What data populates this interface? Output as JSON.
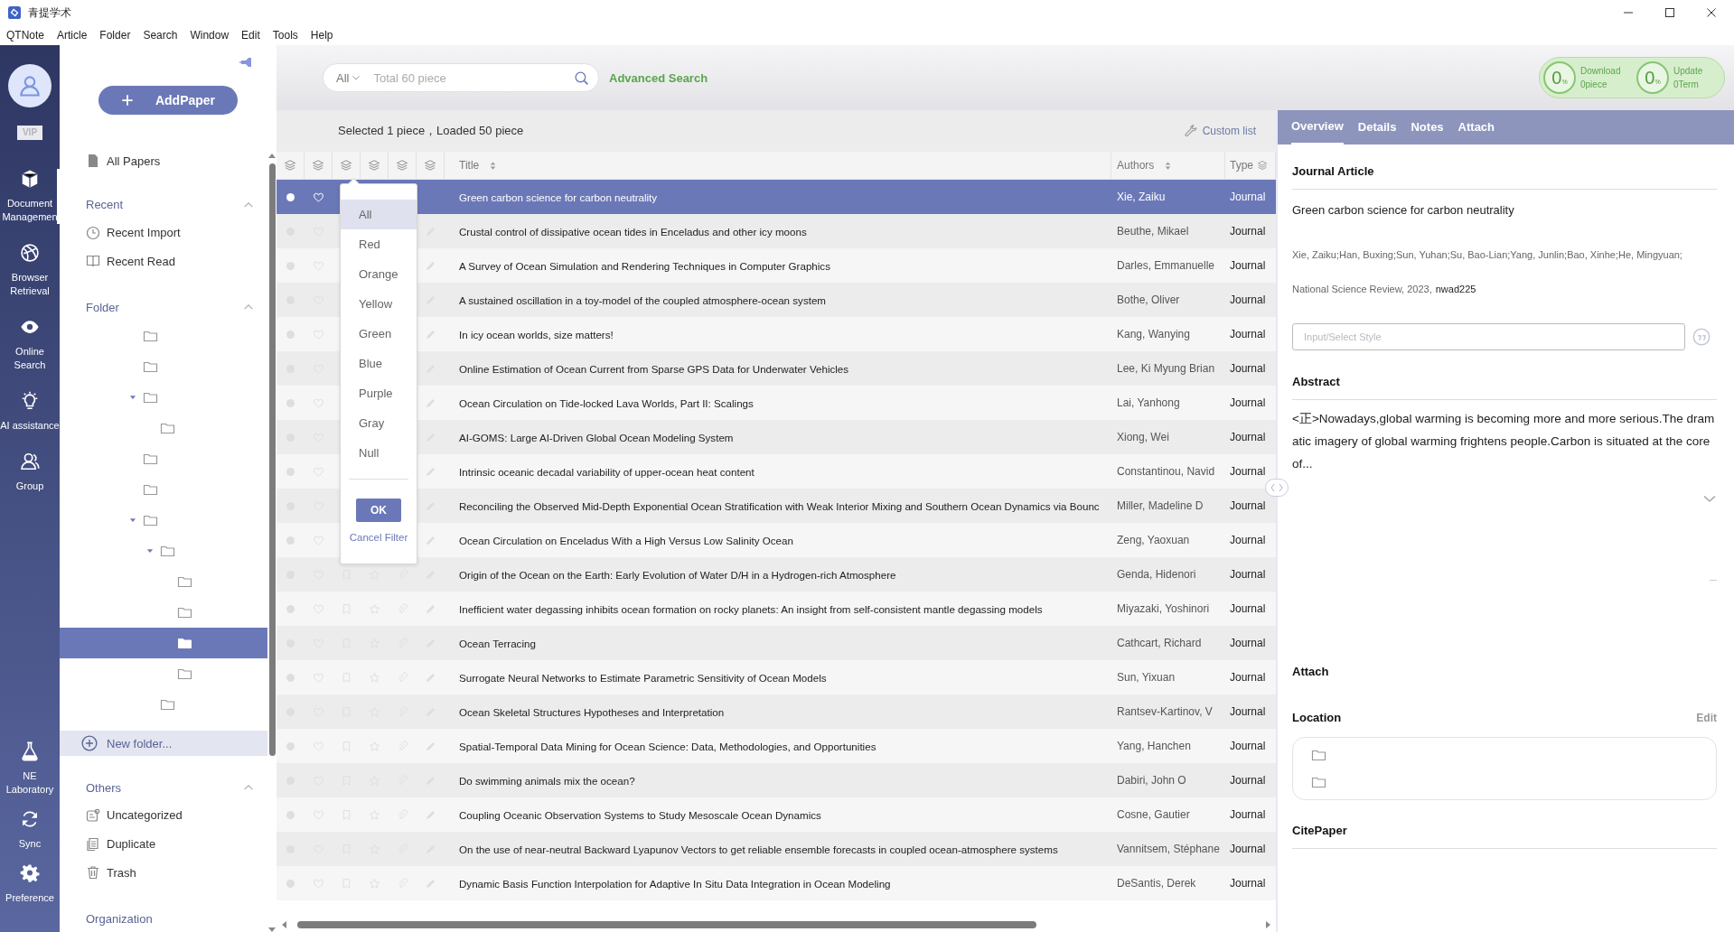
{
  "window": {
    "title": "青提学术"
  },
  "menu": [
    "QTNote",
    "Article",
    "Folder",
    "Search",
    "Window",
    "Edit",
    "Tools",
    "Help"
  ],
  "nav": {
    "badge": "VIP",
    "items": [
      {
        "label": "Document Managemen",
        "selected": true
      },
      {
        "label": "Browser Retrieval",
        "selected": false
      },
      {
        "label": "Online Search",
        "selected": false
      },
      {
        "label": "AI assistance",
        "selected": false
      },
      {
        "label": "Group",
        "selected": false
      }
    ],
    "bottom_items": [
      {
        "label": "NE Laboratory",
        "selected": false
      },
      {
        "label": "Sync",
        "selected": false
      },
      {
        "label": "Preference",
        "selected": false
      }
    ]
  },
  "sidebar": {
    "add_button": "AddPaper",
    "all_papers": "All Papers",
    "recent": {
      "title": "Recent",
      "expanded": true,
      "items": [
        "Recent Import",
        "Recent Read"
      ]
    },
    "folder": {
      "title": "Folder",
      "expanded": true,
      "new_folder": "New folder...",
      "folders": [
        {
          "selected": false
        },
        {
          "selected": false
        },
        {
          "selected": false,
          "expanded": true,
          "children": [
            {
              "selected": false
            }
          ]
        },
        {
          "selected": false
        },
        {
          "selected": false
        },
        {
          "selected": false,
          "expanded": true,
          "children": [
            {
              "selected": false,
              "expanded": true,
              "children": [
                {
                  "selected": false
                },
                {
                  "selected": false
                },
                {
                  "selected": true
                },
                {
                  "selected": false
                }
              ]
            },
            {
              "selected": false
            }
          ]
        }
      ]
    },
    "others": {
      "title": "Others",
      "expanded": true,
      "items": [
        "Uncategorized",
        "Duplicate",
        "Trash"
      ]
    },
    "organization": {
      "title": "Organization"
    }
  },
  "toolbar": {
    "filter": "All",
    "placeholder": "Total 60 piece",
    "advanced_search": "Advanced Search",
    "progress": [
      {
        "value": "0",
        "unit": "%",
        "label": "Download",
        "detail": "0piece"
      },
      {
        "value": "0",
        "unit": "%",
        "label": "Update",
        "detail": "0Term"
      }
    ]
  },
  "table": {
    "summary": "Selected 1 piece，Loaded 50 piece",
    "custom_list": "Custom list",
    "columns": [
      "Title",
      "Authors",
      "Type"
    ],
    "rows": [
      {
        "title": "Green carbon science for carbon neutrality",
        "authors": "Xie, Zaiku",
        "type": "Journal",
        "selected": true
      },
      {
        "title": "Crustal control of dissipative ocean tides in Enceladus and other icy moons",
        "authors": "Beuthe, Mikael",
        "type": "Journal",
        "selected": false
      },
      {
        "title": "A Survey of Ocean Simulation and Rendering Techniques in Computer Graphics",
        "authors": "Darles, Emmanuelle",
        "type": "Journal",
        "selected": false
      },
      {
        "title": "A sustained oscillation in a toy-model of the coupled atmosphere-ocean system",
        "authors": "Bothe, Oliver",
        "type": "Journal",
        "selected": false
      },
      {
        "title": "In icy ocean worlds, size matters!",
        "authors": "Kang, Wanying",
        "type": "Journal",
        "selected": false
      },
      {
        "title": "Online Estimation of Ocean Current from Sparse GPS Data for Underwater Vehicles",
        "authors": "Lee, Ki Myung Brian",
        "type": "Journal",
        "selected": false
      },
      {
        "title": "Ocean Circulation on Tide-locked Lava Worlds, Part II: Scalings",
        "authors": "Lai, Yanhong",
        "type": "Journal",
        "selected": false
      },
      {
        "title": "AI-GOMS: Large AI-Driven Global Ocean Modeling System",
        "authors": "Xiong, Wei",
        "type": "Journal",
        "selected": false
      },
      {
        "title": "Intrinsic oceanic decadal variability of upper-ocean heat content",
        "authors": "Constantinou, Navid",
        "type": "Journal",
        "selected": false
      },
      {
        "title": "Reconciling the Observed Mid-Depth Exponential Ocean Stratification with Weak Interior Mixing and Southern Ocean Dynamics via Bounc",
        "authors": "Miller, Madeline D",
        "type": "Journal",
        "selected": false
      },
      {
        "title": "Ocean Circulation on Enceladus With a High Versus Low Salinity Ocean",
        "authors": "Zeng, Yaoxuan",
        "type": "Journal",
        "selected": false
      },
      {
        "title": "Origin of the Ocean on the Earth: Early Evolution of Water D/H in a Hydrogen-rich Atmosphere",
        "authors": "Genda, Hidenori",
        "type": "Journal",
        "selected": false
      },
      {
        "title": "Inefficient water degassing inhibits ocean formation on rocky planets: An insight from self-consistent mantle degassing models",
        "authors": "Miyazaki, Yoshinori",
        "type": "Journal",
        "selected": false
      },
      {
        "title": "Ocean Terracing",
        "authors": "Cathcart, Richard",
        "type": "Journal",
        "selected": false
      },
      {
        "title": "Surrogate Neural Networks to Estimate Parametric Sensitivity of Ocean Models",
        "authors": "Sun, Yixuan",
        "type": "Journal",
        "selected": false
      },
      {
        "title": "Ocean Skeletal Structures Hypotheses and Interpretation",
        "authors": "Rantsev-Kartinov, V",
        "type": "Journal",
        "selected": false
      },
      {
        "title": "Spatial-Temporal Data Mining for Ocean Science: Data, Methodologies, and Opportunities",
        "authors": "Yang, Hanchen",
        "type": "Journal",
        "selected": false
      },
      {
        "title": "Do swimming animals mix the ocean?",
        "authors": "Dabiri, John O",
        "type": "Journal",
        "selected": false
      },
      {
        "title": "Coupling Oceanic Observation Systems to Study Mesoscale Ocean Dynamics",
        "authors": "Cosne, Gautier",
        "type": "Journal",
        "selected": false
      },
      {
        "title": "On the use of near-neutral Backward Lyapunov Vectors to get reliable ensemble forecasts in coupled ocean-atmosphere systems",
        "authors": "Vannitsem, Stéphane",
        "type": "Journal",
        "selected": false
      },
      {
        "title": "Dynamic Basis Function Interpolation for Adaptive In Situ Data Integration in Ocean Modeling",
        "authors": "DeSantis, Derek",
        "type": "Journal",
        "selected": false
      }
    ]
  },
  "color_filter": {
    "open": true,
    "options": [
      {
        "label": "All",
        "selected": true
      },
      {
        "label": "Red",
        "selected": false
      },
      {
        "label": "Orange",
        "selected": false
      },
      {
        "label": "Yellow",
        "selected": false
      },
      {
        "label": "Green",
        "selected": false
      },
      {
        "label": "Blue",
        "selected": false
      },
      {
        "label": "Purple",
        "selected": false
      },
      {
        "label": "Gray",
        "selected": false
      },
      {
        "label": "Null",
        "selected": false
      }
    ],
    "ok": "OK",
    "cancel": "Cancel Filter"
  },
  "details": {
    "tabs": [
      {
        "label": "Overview",
        "selected": true
      },
      {
        "label": "Details",
        "selected": false
      },
      {
        "label": "Notes",
        "selected": false
      },
      {
        "label": "Attach",
        "selected": false
      }
    ],
    "type_heading": "Journal Article",
    "title": "Green carbon science for carbon neutrality",
    "authors": "Xie, Zaiku;Han, Buxing;Sun, Yuhan;Su, Bao-Lian;Yang, Junlin;Bao, Xinhe;He, Mingyuan;",
    "source": "National Science Review, 2023,",
    "source_id": "nwad225",
    "style_placeholder": "Input/Select Style",
    "abstract_heading": "Abstract",
    "abstract": "<正>Nowadays,global warming is becoming more and more serious.The dramatic imagery of global warming frightens people.Carbon is situated at the core of...",
    "attach_heading": "Attach",
    "location_heading": "Location",
    "edit": "Edit",
    "cite_heading": "CitePaper"
  }
}
